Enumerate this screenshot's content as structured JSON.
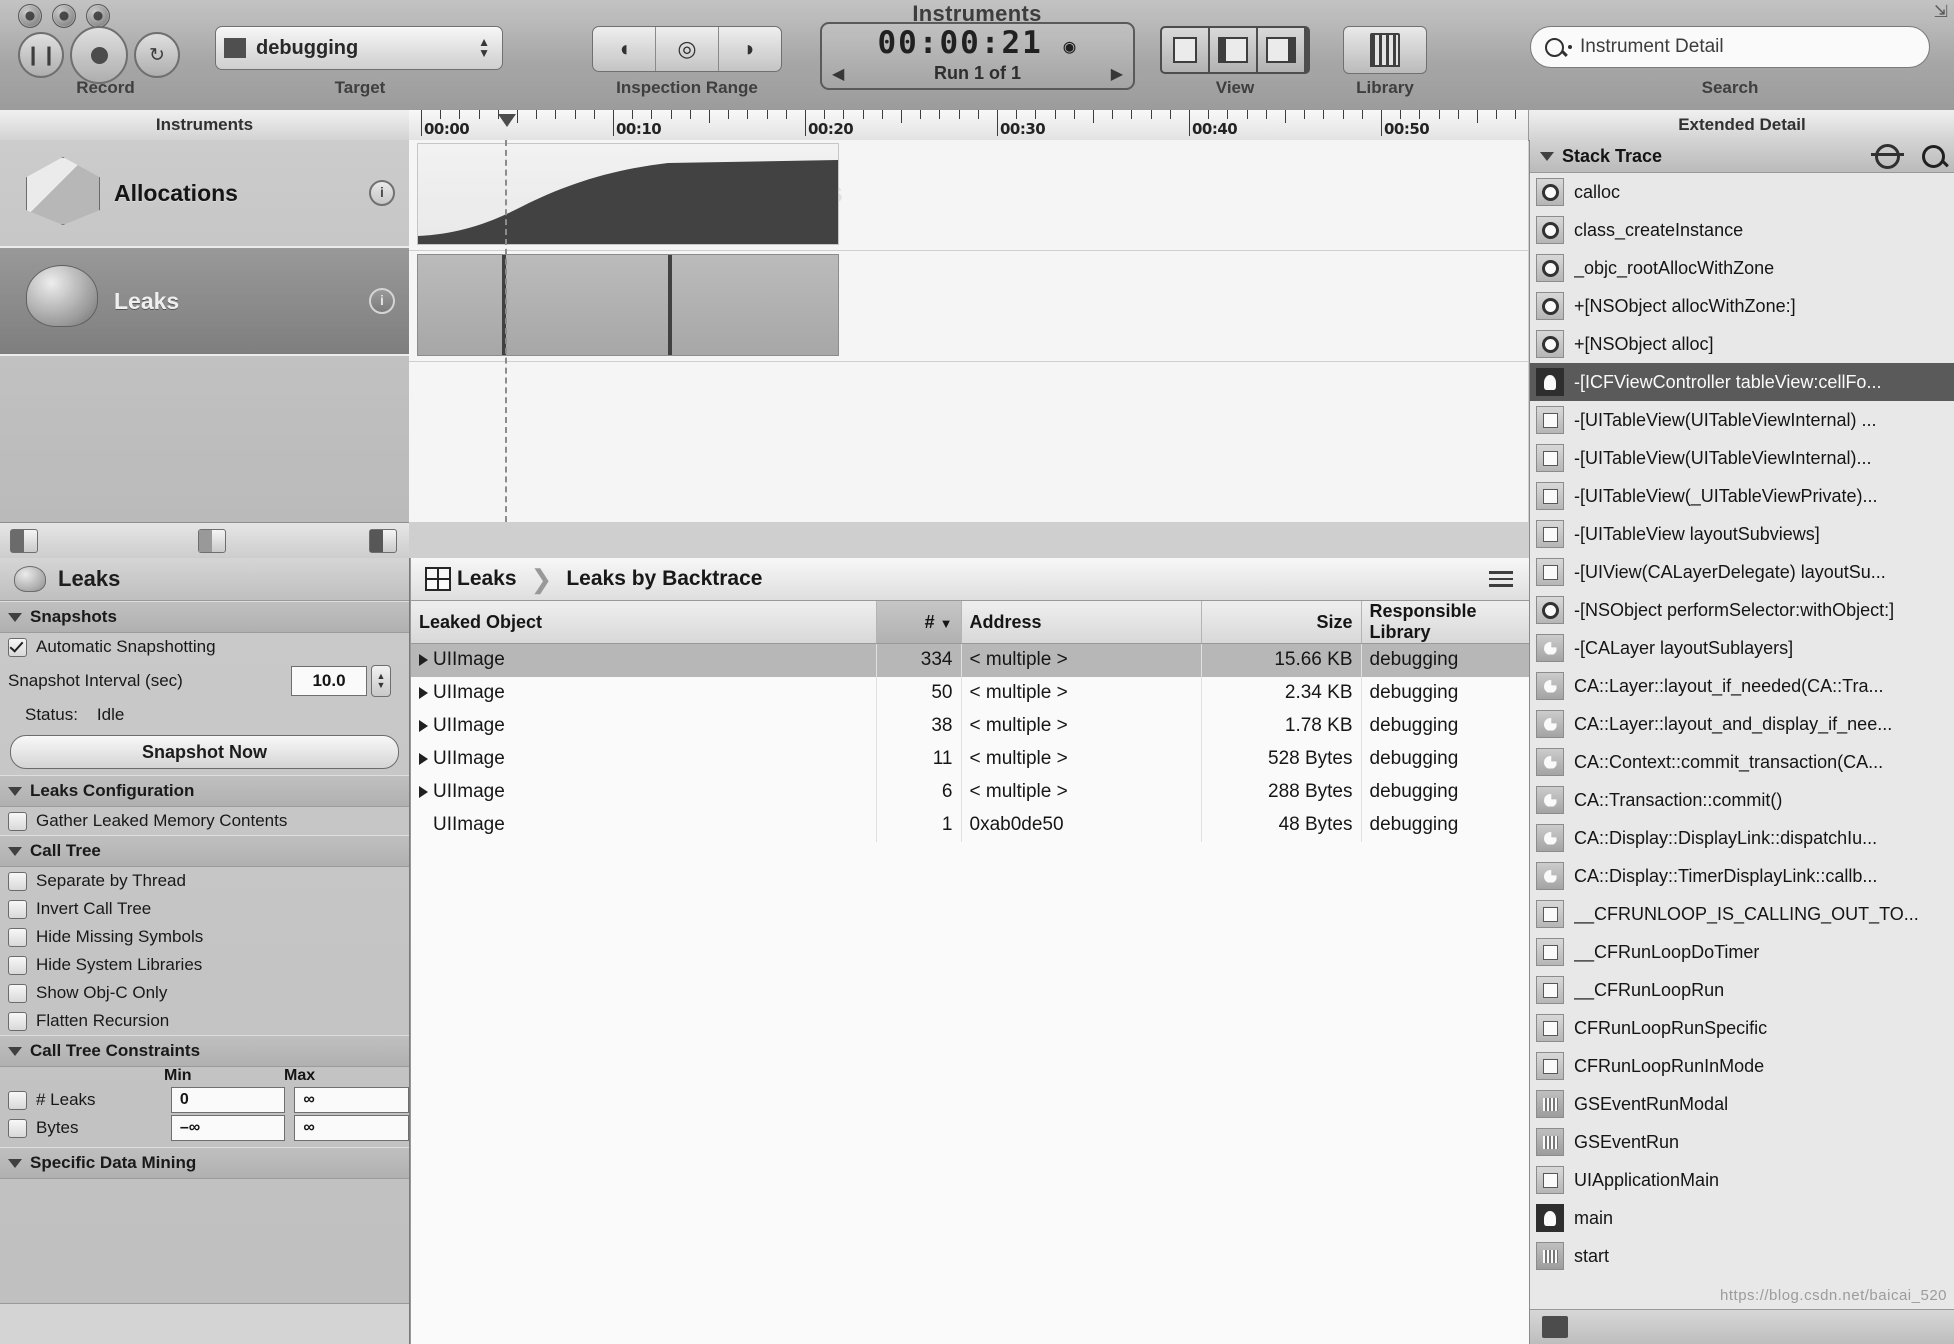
{
  "window": {
    "title": "Instruments"
  },
  "toolbar": {
    "record": {
      "caption": "Record",
      "pause_icon": "pause-icon",
      "record_icon": "record-icon",
      "loop_icon": "loop-icon"
    },
    "target": {
      "caption": "Target",
      "value": "debugging"
    },
    "inspection_range": {
      "caption": "Inspection Range",
      "buttons": [
        "range-start-icon",
        "range-mid-icon",
        "range-end-icon"
      ]
    },
    "timer": {
      "time": "00:00:21",
      "run": "Run 1 of 1",
      "clock_icon": "clock-icon",
      "prev_icon": "prev-arrow-icon",
      "next_icon": "next-arrow-icon"
    },
    "view": {
      "caption": "View",
      "segments": [
        "view-left-pane",
        "view-middle-pane",
        "view-right-pane"
      ]
    },
    "library": {
      "caption": "Library",
      "icon": "library-icon"
    },
    "search": {
      "caption": "Search",
      "placeholder": "Instrument Detail",
      "icon": "search-icon"
    }
  },
  "panes": {
    "instruments_header": "Instruments",
    "extended_header": "Extended Detail"
  },
  "timeline": {
    "ticks": [
      "00:00",
      "00:10",
      "00:20",
      "00:30",
      "00:40",
      "00:50"
    ]
  },
  "instruments": [
    {
      "name": "Allocations",
      "icon": "allocations-icon",
      "badge": "i",
      "selected": false
    },
    {
      "name": "Leaks",
      "icon": "leaks-icon",
      "badge": "i",
      "selected": true
    }
  ],
  "config": {
    "title": "Leaks",
    "title_icon": "leaks-icon",
    "sections": {
      "snapshots": {
        "label": "Snapshots",
        "automatic_snapshotting": {
          "label": "Automatic Snapshotting",
          "checked": true
        },
        "interval": {
          "label": "Snapshot Interval (sec)",
          "value": "10.0"
        },
        "status": {
          "label": "Status:",
          "value": "Idle"
        },
        "snapshot_now": "Snapshot Now"
      },
      "leaks_configuration": {
        "label": "Leaks Configuration",
        "gather": {
          "label": "Gather Leaked Memory Contents",
          "checked": false
        }
      },
      "call_tree": {
        "label": "Call Tree",
        "options": [
          {
            "label": "Separate by Thread",
            "checked": false
          },
          {
            "label": "Invert Call Tree",
            "checked": false
          },
          {
            "label": "Hide Missing Symbols",
            "checked": false
          },
          {
            "label": "Hide System Libraries",
            "checked": false
          },
          {
            "label": "Show Obj-C Only",
            "checked": false
          },
          {
            "label": "Flatten Recursion",
            "checked": false
          }
        ]
      },
      "call_tree_constraints": {
        "label": "Call Tree Constraints",
        "col_min": "Min",
        "col_max": "Max",
        "rows": [
          {
            "label": "# Leaks",
            "checked": false,
            "min": "0",
            "max": "∞"
          },
          {
            "label": "Bytes",
            "checked": false,
            "min": "–∞",
            "max": "∞"
          }
        ]
      },
      "specific_data_mining": {
        "label": "Specific Data Mining"
      }
    }
  },
  "detail": {
    "breadcrumb": {
      "icon": "grid-icon",
      "root": "Leaks",
      "current": "Leaks by Backtrace",
      "menu_icon": "hamburger-icon"
    },
    "columns": [
      "Leaked Object",
      "#",
      "Address",
      "Size",
      "Responsible Library"
    ],
    "sort_column": "#",
    "rows": [
      {
        "object": "UIImage",
        "count": "334",
        "address": "< multiple >",
        "size": "15.66 KB",
        "library": "debugging",
        "expandable": true,
        "selected": true
      },
      {
        "object": "UIImage",
        "count": "50",
        "address": "< multiple >",
        "size": "2.34 KB",
        "library": "debugging",
        "expandable": true,
        "selected": false
      },
      {
        "object": "UIImage",
        "count": "38",
        "address": "< multiple >",
        "size": "1.78 KB",
        "library": "debugging",
        "expandable": true,
        "selected": false
      },
      {
        "object": "UIImage",
        "count": "11",
        "address": "< multiple >",
        "size": "528 Bytes",
        "library": "debugging",
        "expandable": true,
        "selected": false
      },
      {
        "object": "UIImage",
        "count": "6",
        "address": "< multiple >",
        "size": "288 Bytes",
        "library": "debugging",
        "expandable": true,
        "selected": false
      },
      {
        "object": "UIImage",
        "count": "1",
        "address": "0xab0de50",
        "size": "48 Bytes",
        "library": "debugging",
        "expandable": false,
        "selected": false
      }
    ]
  },
  "extended_detail": {
    "stack_trace": {
      "label": "Stack Trace",
      "gear_icon": "gear-icon",
      "search_icon": "search-icon"
    },
    "frames": [
      {
        "text": "calloc",
        "icon": "dot",
        "selected": false
      },
      {
        "text": "class_createInstance",
        "icon": "dot",
        "selected": false
      },
      {
        "text": "_objc_rootAllocWithZone",
        "icon": "dot",
        "selected": false
      },
      {
        "text": "+[NSObject allocWithZone:]",
        "icon": "dot",
        "selected": false
      },
      {
        "text": "+[NSObject alloc]",
        "icon": "dot",
        "selected": false
      },
      {
        "text": "-[ICFViewController tableView:cellFo...",
        "icon": "person",
        "selected": true
      },
      {
        "text": "-[UITableView(UITableViewInternal) ...",
        "icon": "sq",
        "selected": false
      },
      {
        "text": "-[UITableView(UITableViewInternal)...",
        "icon": "sq",
        "selected": false
      },
      {
        "text": "-[UITableView(_UITableViewPrivate)...",
        "icon": "sq",
        "selected": false
      },
      {
        "text": "-[UITableView layoutSubviews]",
        "icon": "sq",
        "selected": false
      },
      {
        "text": "-[UIView(CALayerDelegate) layoutSu...",
        "icon": "sq",
        "selected": false
      },
      {
        "text": "-[NSObject performSelector:withObject:]",
        "icon": "dot",
        "selected": false
      },
      {
        "text": "-[CALayer layoutSublayers]",
        "icon": "ca",
        "selected": false
      },
      {
        "text": "CA::Layer::layout_if_needed(CA::Tra...",
        "icon": "ca",
        "selected": false
      },
      {
        "text": "CA::Layer::layout_and_display_if_nee...",
        "icon": "ca",
        "selected": false
      },
      {
        "text": "CA::Context::commit_transaction(CA...",
        "icon": "ca",
        "selected": false
      },
      {
        "text": "CA::Transaction::commit()",
        "icon": "ca",
        "selected": false
      },
      {
        "text": "CA::Display::DisplayLink::dispatchIu...",
        "icon": "ca",
        "selected": false
      },
      {
        "text": "CA::Display::TimerDisplayLink::callb...",
        "icon": "ca",
        "selected": false
      },
      {
        "text": "__CFRUNLOOP_IS_CALLING_OUT_TO...",
        "icon": "sq",
        "selected": false
      },
      {
        "text": "__CFRunLoopDoTimer",
        "icon": "sq",
        "selected": false
      },
      {
        "text": "__CFRunLoopRun",
        "icon": "sq",
        "selected": false
      },
      {
        "text": "CFRunLoopRunSpecific",
        "icon": "sq",
        "selected": false
      },
      {
        "text": "CFRunLoopRunInMode",
        "icon": "sq",
        "selected": false
      },
      {
        "text": "GSEventRunModal",
        "icon": "start",
        "selected": false
      },
      {
        "text": "GSEventRun",
        "icon": "start",
        "selected": false
      },
      {
        "text": "UIApplicationMain",
        "icon": "sq",
        "selected": false
      },
      {
        "text": "main",
        "icon": "person",
        "selected": false
      },
      {
        "text": "start",
        "icon": "start",
        "selected": false
      }
    ],
    "watermark": "https://blog.csdn.net/baicai_520"
  }
}
